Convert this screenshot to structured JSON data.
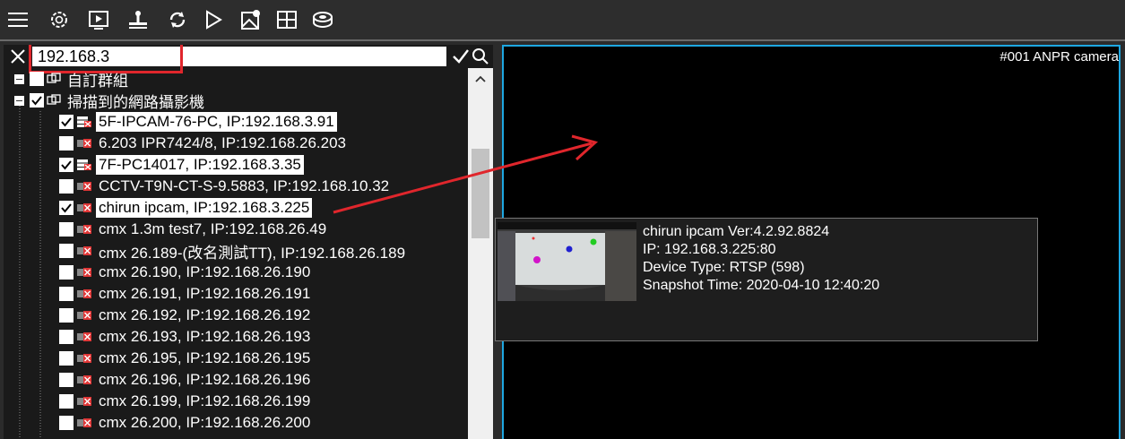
{
  "toolbar": {
    "icons": [
      "menu-icon",
      "settings-icon",
      "playback-icon",
      "upload-icon",
      "refresh-icon",
      "play-icon",
      "map-icon",
      "layout-icon",
      "storage-icon"
    ]
  },
  "search": {
    "value": "192.168.3"
  },
  "tree": {
    "groups": [
      {
        "label": "自訂群組"
      },
      {
        "label": "掃描到的網路攝影機"
      }
    ],
    "devices": [
      {
        "label": "5F-IPCAM-76-PC, IP:192.168.3.91",
        "checked": true,
        "highlighted": true,
        "status": "online"
      },
      {
        "label": "6.203 IPR7424/8, IP:192.168.26.203",
        "checked": false,
        "highlighted": false,
        "status": "offline"
      },
      {
        "label": "7F-PC14017, IP:192.168.3.35",
        "checked": true,
        "highlighted": true,
        "status": "online"
      },
      {
        "label": "CCTV-T9N-CT-S-9.5883, IP:192.168.10.32",
        "checked": false,
        "highlighted": false,
        "status": "offline"
      },
      {
        "label": "chirun ipcam, IP:192.168.3.225",
        "checked": true,
        "highlighted": true,
        "status": "offline"
      },
      {
        "label": "cmx 1.3m test7, IP:192.168.26.49",
        "checked": false,
        "highlighted": false,
        "status": "offline"
      },
      {
        "label": "cmx 26.189-(改名測試TT), IP:192.168.26.189",
        "checked": false,
        "highlighted": false,
        "status": "offline"
      },
      {
        "label": "cmx 26.190, IP:192.168.26.190",
        "checked": false,
        "highlighted": false,
        "status": "offline"
      },
      {
        "label": "cmx 26.191, IP:192.168.26.191",
        "checked": false,
        "highlighted": false,
        "status": "offline"
      },
      {
        "label": "cmx 26.192, IP:192.168.26.192",
        "checked": false,
        "highlighted": false,
        "status": "offline"
      },
      {
        "label": "cmx 26.193, IP:192.168.26.193",
        "checked": false,
        "highlighted": false,
        "status": "offline"
      },
      {
        "label": "cmx 26.195, IP:192.168.26.195",
        "checked": false,
        "highlighted": false,
        "status": "offline"
      },
      {
        "label": "cmx 26.196, IP:192.168.26.196",
        "checked": false,
        "highlighted": false,
        "status": "offline"
      },
      {
        "label": "cmx 26.199, IP:192.168.26.199",
        "checked": false,
        "highlighted": false,
        "status": "offline"
      },
      {
        "label": "cmx 26.200, IP:192.168.26.200",
        "checked": false,
        "highlighted": false,
        "status": "offline"
      }
    ]
  },
  "video": {
    "channel_label": "#001 ANPR camera"
  },
  "tooltip": {
    "title": "chirun ipcam Ver:4.2.92.8824",
    "ip": "IP: 192.168.3.225:80",
    "device_type": "Device Type: RTSP (598)",
    "snapshot_time": "Snapshot Time: 2020-04-10 12:40:20"
  },
  "colors": {
    "accent_border": "#1ea7e1",
    "annotation_red": "#e0262c",
    "background": "#1a1a1a"
  }
}
